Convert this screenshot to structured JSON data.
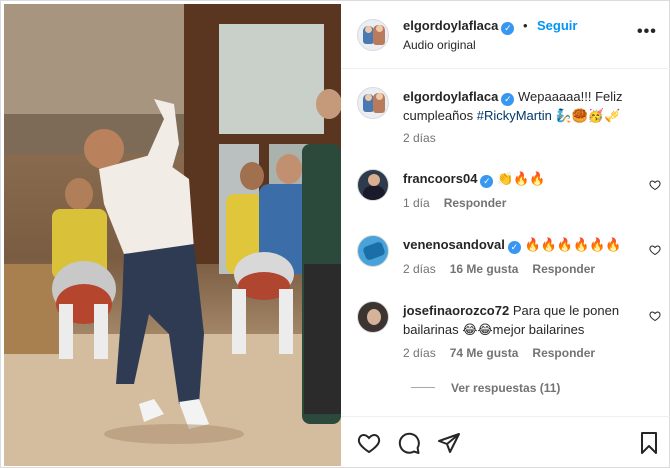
{
  "post": {
    "author": "elgordoylaflaca",
    "separator": "•",
    "follow_label": "Seguir",
    "subtitle": "Audio original",
    "more_label": "•••"
  },
  "caption": {
    "author": "elgordoylaflaca",
    "text_line1": "Wepaaaaa!!! Feliz",
    "text_line2_prefix": "cumpleaños ",
    "hashtag": "#RickyMartin",
    "emojis": "🧞🥮🥳🎺",
    "time": "2 días"
  },
  "comments": [
    {
      "author": "francoors04",
      "text": "👏🔥🔥",
      "time": "1 día",
      "likes": "",
      "reply_label": "Responder"
    },
    {
      "author": "venenosandoval",
      "text": "🔥🔥🔥🔥🔥🔥",
      "time": "2 días",
      "likes": "16 Me gusta",
      "reply_label": "Responder"
    },
    {
      "author": "josefinaorozco72",
      "text_line1": "Para que le ponen",
      "text_line2": "bailarinas 😂😂mejor bailarines",
      "time": "2 días",
      "likes": "74 Me gusta",
      "reply_label": "Responder"
    }
  ],
  "view_replies": "Ver respuestas (11)",
  "icons": [
    "heart-icon",
    "comment-icon",
    "share-icon",
    "bookmark-icon",
    "more-icon",
    "verified-icon"
  ],
  "colors": {
    "link": "#0095f6",
    "verified": "#3897f0",
    "hashtag": "#00376b"
  }
}
